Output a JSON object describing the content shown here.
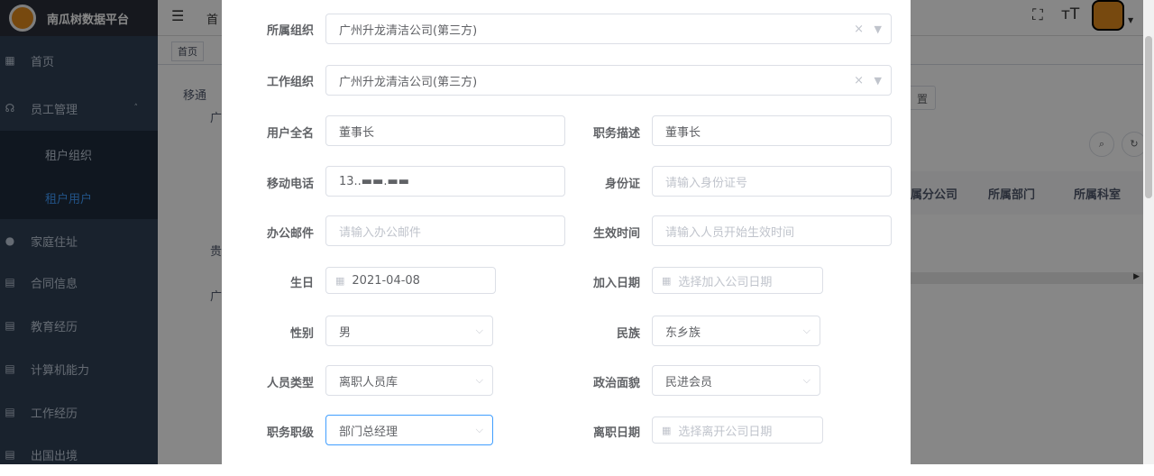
{
  "app": {
    "title": "南瓜树数据平台"
  },
  "sidebar": {
    "items": [
      {
        "label": "首页",
        "icon": "dashboard-icon"
      },
      {
        "label": "员工管理",
        "icon": "people-icon"
      },
      {
        "label": "租户组织"
      },
      {
        "label": "租户用户",
        "active": true
      },
      {
        "label": "家庭住址",
        "icon": "user-icon"
      },
      {
        "label": "合同信息",
        "icon": "document-icon"
      },
      {
        "label": "教育经历",
        "icon": "document-icon"
      },
      {
        "label": "计算机能力",
        "icon": "document-icon"
      },
      {
        "label": "工作经历",
        "icon": "document-icon"
      },
      {
        "label": "出国出境",
        "icon": "document-icon"
      }
    ]
  },
  "navbar": {
    "breadcrumb": "首",
    "tag": "首页"
  },
  "background": {
    "tree": [
      "移通",
      "广",
      "贵",
      "广"
    ],
    "button_fragment": "置",
    "columns": [
      "属分公司",
      "所属部门",
      "所属科室"
    ]
  },
  "form": {
    "org": {
      "label": "所属组织",
      "value": "广州升龙清洁公司(第三方)"
    },
    "work_org": {
      "label": "工作组织",
      "value": "广州升龙清洁公司(第三方)"
    },
    "full_name": {
      "label": "用户全名",
      "value": "董事长"
    },
    "job_desc": {
      "label": "职务描述",
      "value": "董事长"
    },
    "mobile": {
      "label": "移动电话",
      "value": "13..▬▬.▬▬"
    },
    "id_card": {
      "label": "身份证",
      "placeholder": "请输入身份证号"
    },
    "email": {
      "label": "办公邮件",
      "placeholder": "请输入办公邮件"
    },
    "effective": {
      "label": "生效时间",
      "placeholder": "请输入人员开始生效时间"
    },
    "birthday": {
      "label": "生日",
      "value": "2021-04-08"
    },
    "join_date": {
      "label": "加入日期",
      "placeholder": "选择加入公司日期"
    },
    "gender": {
      "label": "性别",
      "value": "男"
    },
    "ethnicity": {
      "label": "民族",
      "value": "东乡族"
    },
    "person_type": {
      "label": "人员类型",
      "value": "离职人员库"
    },
    "political": {
      "label": "政治面貌",
      "value": "民进会员"
    },
    "rank": {
      "label": "职务职级",
      "value": "部门总经理"
    },
    "leave_date": {
      "label": "离职日期",
      "placeholder": "选择离开公司日期"
    }
  }
}
